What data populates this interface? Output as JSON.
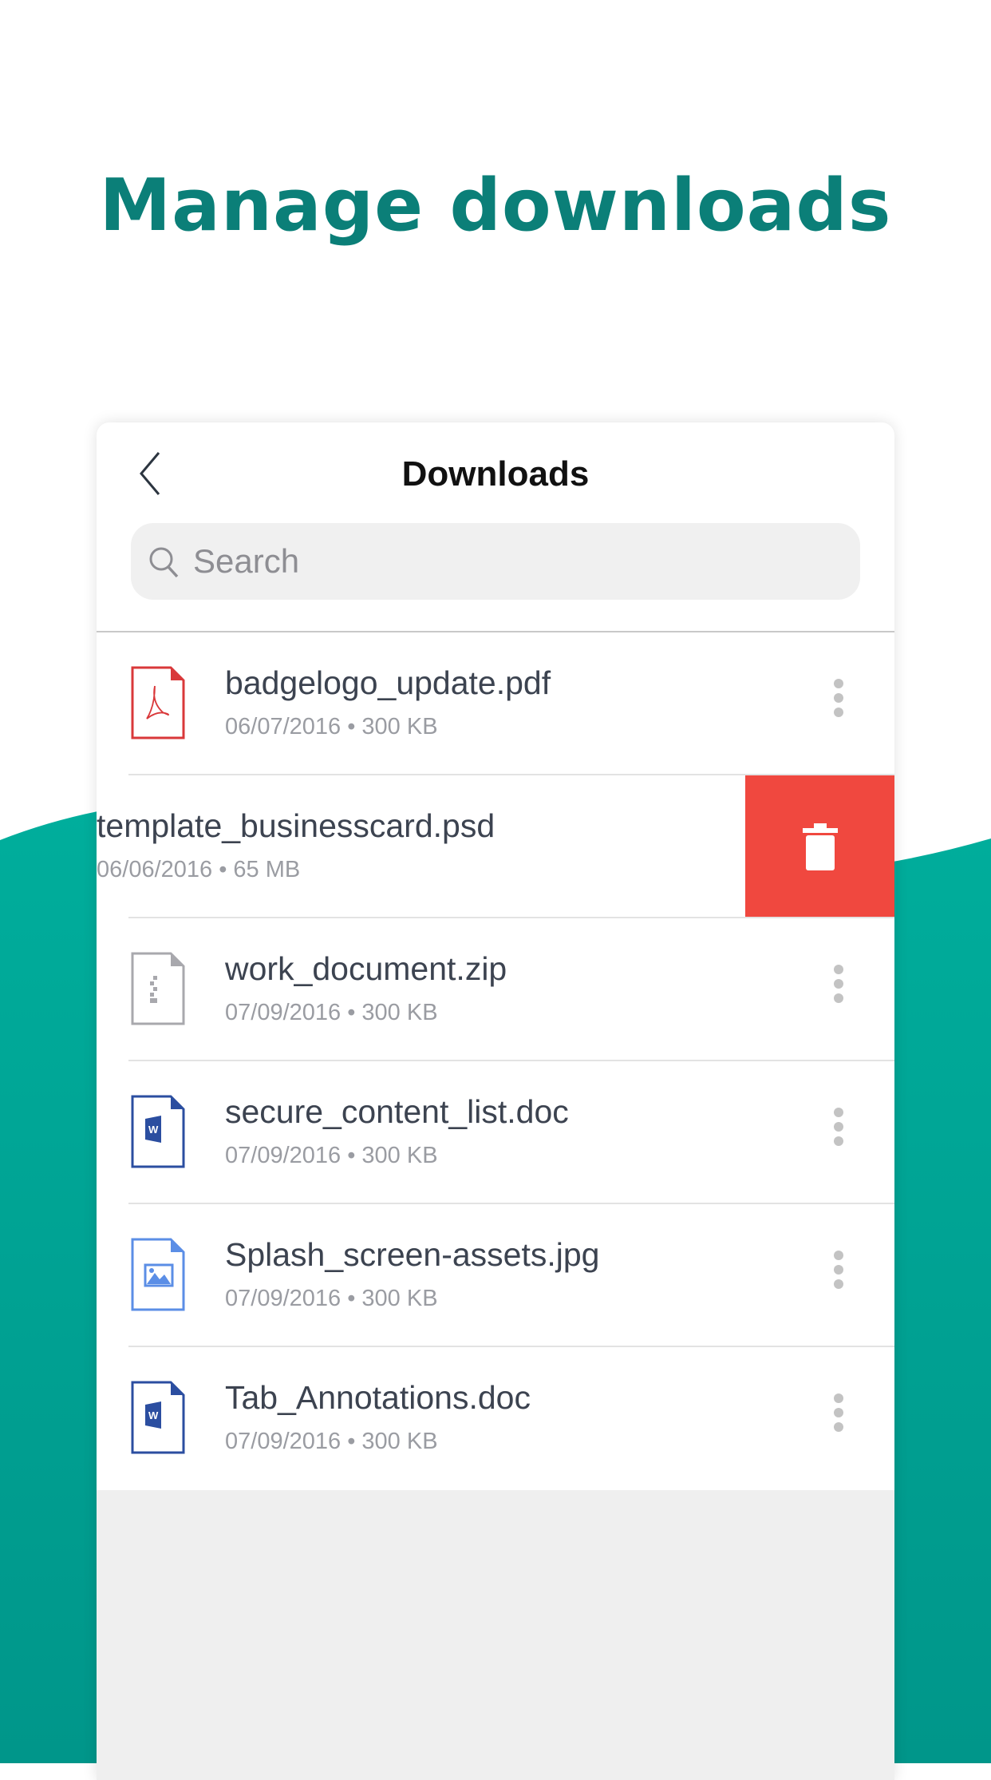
{
  "headline": "Manage downloads",
  "colors": {
    "accent": "#0b7f78",
    "wave": "#00a797",
    "delete": "#f0483f"
  },
  "nav": {
    "title": "Downloads",
    "back_icon": "chevron-left-icon"
  },
  "search": {
    "placeholder": "Search"
  },
  "files": [
    {
      "name": "badgelogo_update.pdf",
      "date": "06/07/2016",
      "size": "300 KB",
      "meta": "06/07/2016 • 300 KB",
      "type": "pdf"
    },
    {
      "name": "template_businesscard.psd",
      "date": "06/06/2016",
      "size": "65 MB",
      "meta": "06/06/2016 • 65 MB",
      "type": "psd",
      "swiped": true
    },
    {
      "name": "work_document.zip",
      "date": "07/09/2016",
      "size": "300 KB",
      "meta": "07/09/2016 • 300 KB",
      "type": "zip"
    },
    {
      "name": "secure_content_list.doc",
      "date": "07/09/2016",
      "size": "300 KB",
      "meta": "07/09/2016 • 300 KB",
      "type": "doc"
    },
    {
      "name": "Splash_screen-assets.jpg",
      "date": "07/09/2016",
      "size": "300 KB",
      "meta": "07/09/2016 • 300 KB",
      "type": "jpg"
    },
    {
      "name": "Tab_Annotations.doc",
      "date": "07/09/2016",
      "size": "300 KB",
      "meta": "07/09/2016 • 300 KB",
      "type": "doc"
    }
  ]
}
